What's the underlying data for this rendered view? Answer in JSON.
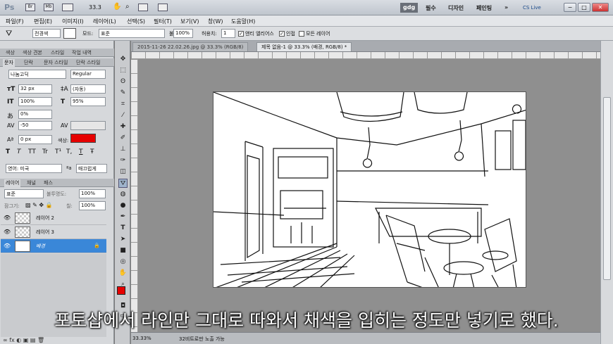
{
  "titlebar": {
    "logo": "Ps",
    "zoom": "33.3",
    "workspaces": [
      "gdg",
      "필수",
      "디자인",
      "페인팅"
    ],
    "more": "»",
    "cslive": "CS Live",
    "win_min": "−",
    "win_max": "□",
    "win_close": "✕"
  },
  "menubar": [
    "파일(F)",
    "편집(E)",
    "이미지(I)",
    "레이어(L)",
    "선택(S)",
    "필터(T)",
    "보기(V)",
    "창(W)",
    "도움말(H)"
  ],
  "options": {
    "brush_size": "전경색",
    "mode_label": "모드:",
    "mode_value": "표준",
    "opacity_label": "불투명도:",
    "opacity_value": "100%",
    "tolerance_label": "허용치:",
    "tolerance_value": "1",
    "antialias_label": "앤티 앨리어스",
    "contiguous_label": "인접",
    "all_layers_label": "모든 레이어"
  },
  "panels": {
    "top_tabs": [
      "색상",
      "색상 견본",
      "스타일",
      "작업 내역"
    ],
    "char_tabs": [
      "문자",
      "단락",
      "문자 스타일",
      "단락 스타일"
    ],
    "font_family": "나눔고딕",
    "font_style": "Regular",
    "font_size": "32 px",
    "leading": "(자동)",
    "vscale": "100%",
    "hscale": "95%",
    "tracking_pct": "0%",
    "kerning": "-50",
    "baseline": "0 px",
    "color_label": "색상:",
    "text_color": "#e60000",
    "type_buttons": [
      "T",
      "T",
      "TT",
      "Tr",
      "T¹",
      "T,",
      "T",
      "Ŧ"
    ],
    "language": "영어: 미국",
    "aa_label": "ªa",
    "aa_value": "매끄럽게",
    "layer_tabs": [
      "레이어",
      "채널",
      "패스"
    ],
    "blend_mode": "표준",
    "layer_opacity_label": "불투명도:",
    "layer_opacity": "100%",
    "lock_label": "잠그기:",
    "fill_label": "칠:",
    "fill_value": "100%",
    "layers": [
      {
        "name": "레이어 2",
        "visible": true,
        "selected": false
      },
      {
        "name": "레이어 3",
        "visible": true,
        "selected": false
      },
      {
        "name": "배경",
        "visible": true,
        "selected": true
      }
    ]
  },
  "documents": {
    "tabs": [
      "2015-11-26 22.02.26.jpg @ 33.3% (RGB/8)",
      "제목 없음-1 @ 33.3% (배경, RGB/8) *"
    ],
    "status_zoom": "33.33%",
    "status_text": "32비트로만 노출 가능"
  },
  "subtitle": "포토샵에서 라인만 그대로 따와서 채색을 입히는 정도만 넣기로 했다."
}
